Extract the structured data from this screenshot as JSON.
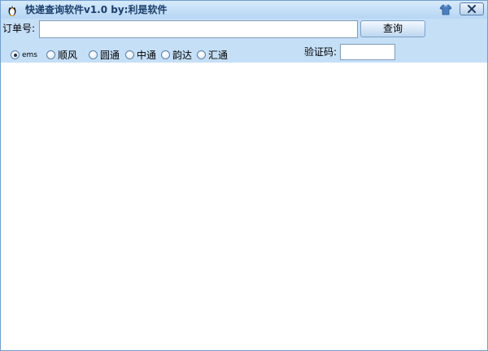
{
  "window": {
    "title": "快递查询软件v1.0   by:利是软件"
  },
  "toolbar": {
    "order_label": "订单号:",
    "order_value": "",
    "query_label": "查询",
    "captcha_label": "验证码:",
    "captcha_value": ""
  },
  "carriers": {
    "selected": "ems",
    "options": [
      {
        "label": "ems",
        "checked": true
      },
      {
        "label": "顺风",
        "checked": false
      },
      {
        "label": "圆通",
        "checked": false
      },
      {
        "label": "中通",
        "checked": false
      },
      {
        "label": "韵达",
        "checked": false
      },
      {
        "label": "汇通",
        "checked": false
      }
    ]
  },
  "icons": {
    "app": "penguin-icon",
    "skin": "skin-shirt-icon",
    "close": "close-icon"
  },
  "colors": {
    "titlebar": "#c9e1f8",
    "toolbar": "#c5dff7",
    "border": "#6f9fd1"
  }
}
